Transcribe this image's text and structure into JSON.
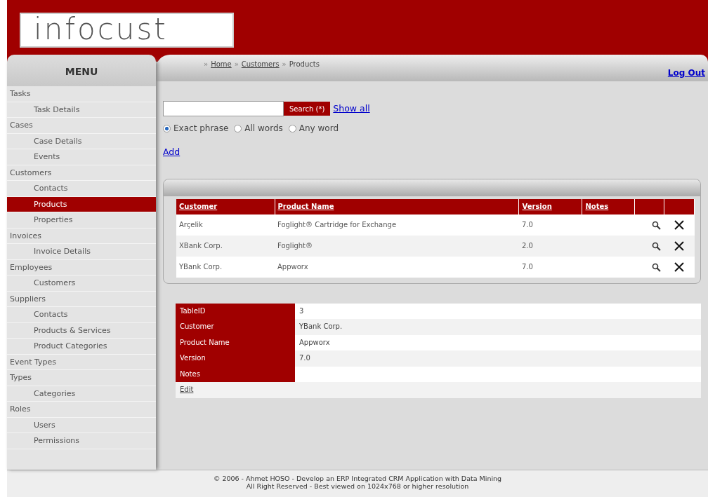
{
  "logo": {
    "text": "infocust"
  },
  "breadcrumb": {
    "separator": "»",
    "items": [
      {
        "label": "Home",
        "link": true
      },
      {
        "label": "Customers",
        "link": true
      },
      {
        "label": "Products",
        "link": false
      }
    ]
  },
  "logout": "Log Out",
  "menu": {
    "title": "MENU",
    "items": [
      {
        "label": "Tasks",
        "selected": false,
        "children": [
          {
            "label": "Task Details",
            "selected": false
          }
        ]
      },
      {
        "label": "Cases",
        "selected": false,
        "children": [
          {
            "label": "Case Details",
            "selected": false
          },
          {
            "label": "Events",
            "selected": false
          }
        ]
      },
      {
        "label": "Customers",
        "selected": false,
        "children": [
          {
            "label": "Contacts",
            "selected": false
          },
          {
            "label": "Products",
            "selected": true
          },
          {
            "label": "Properties",
            "selected": false
          }
        ]
      },
      {
        "label": "Invoices",
        "selected": false,
        "children": [
          {
            "label": "Invoice Details",
            "selected": false
          }
        ]
      },
      {
        "label": "Employees",
        "selected": false,
        "children": [
          {
            "label": "Customers",
            "selected": false
          }
        ]
      },
      {
        "label": "Suppliers",
        "selected": false,
        "children": [
          {
            "label": "Contacts",
            "selected": false
          },
          {
            "label": "Products & Services",
            "selected": false
          },
          {
            "label": "Product Categories",
            "selected": false
          }
        ]
      },
      {
        "label": "Event Types",
        "selected": false
      },
      {
        "label": "Types",
        "selected": false,
        "children": [
          {
            "label": "Categories",
            "selected": false
          }
        ]
      },
      {
        "label": "Roles",
        "selected": false,
        "children": [
          {
            "label": "Users",
            "selected": false
          },
          {
            "label": "Permissions",
            "selected": false
          }
        ]
      }
    ]
  },
  "search": {
    "button": "Search (*)",
    "show_all": "Show all",
    "options": [
      {
        "label": "Exact phrase",
        "selected": true
      },
      {
        "label": "All words",
        "selected": false
      },
      {
        "label": "Any word",
        "selected": false
      }
    ]
  },
  "add_link": "Add",
  "table": {
    "columns": [
      "Customer",
      "Product Name",
      "Version",
      "Notes"
    ],
    "rows": [
      {
        "cells": [
          "Arçelik",
          "Foglight® Cartridge for Exchange",
          "7.0",
          null
        ]
      },
      {
        "cells": [
          "XBank Corp.",
          "Foglight®",
          "2.0",
          null
        ]
      },
      {
        "cells": [
          "YBank Corp.",
          "Appworx",
          "7.0",
          null
        ]
      }
    ]
  },
  "detail": {
    "fields": [
      {
        "label": "TableID",
        "value": "3"
      },
      {
        "label": "Customer",
        "value": "YBank Corp."
      },
      {
        "label": "Product Name",
        "value": "Appworx"
      },
      {
        "label": "Version",
        "value": "7.0"
      },
      {
        "label": "Notes"
      }
    ],
    "edit": "Edit"
  },
  "footer": [
    "© 2006 - Ahmet HOSO - Develop an ERP Integrated CRM Application with Data Mining",
    "All Right Reserved - Best viewed on 1024x768 or higher resolution"
  ]
}
